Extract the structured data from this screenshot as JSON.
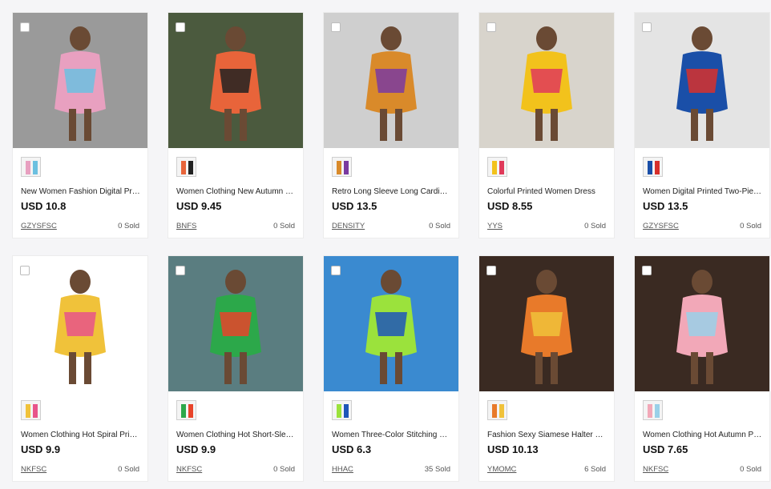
{
  "products": [
    {
      "title": "New Women Fashion Digital Print Shirt Casual Dress",
      "price": "USD 10.8",
      "shop": "GZYSFSC",
      "sold": "0 Sold",
      "bg": "#9a9a9a",
      "accent": "#e8a0c0",
      "accent2": "#6cc0e0"
    },
    {
      "title": "Women Clothing New Autumn Printed Two-Piece Set",
      "price": "USD 9.45",
      "shop": "BNFS",
      "sold": "0 Sold",
      "bg": "#4b5a3e",
      "accent": "#e8643a",
      "accent2": "#222222"
    },
    {
      "title": "Retro Long Sleeve Long Cardigan Tie-Dye Dress",
      "price": "USD 13.5",
      "shop": "DENSITY",
      "sold": "0 Sold",
      "bg": "#cfcfcf",
      "accent": "#d98a2a",
      "accent2": "#7a3aa0"
    },
    {
      "title": "Colorful Printed Women Dress",
      "price": "USD 8.55",
      "shop": "YYS",
      "sold": "0 Sold",
      "bg": "#d8d4cc",
      "accent": "#f2c21c",
      "accent2": "#e03a5a"
    },
    {
      "title": "Women Digital Printed Two-Piece Set",
      "price": "USD 13.5",
      "shop": "GZYSFSC",
      "sold": "0 Sold",
      "bg": "#e4e4e4",
      "accent": "#1a4fa8",
      "accent2": "#d8302c"
    },
    {
      "title": "Women Clothing Hot Spiral Print Tie-Dye Suit",
      "price": "USD 9.9",
      "shop": "NKFSC",
      "sold": "0 Sold",
      "bg": "#ffffff",
      "accent": "#f0c23a",
      "accent2": "#e8548a"
    },
    {
      "title": "Women Clothing Hot Short-Sleeve Printed Jumpsuit",
      "price": "USD 9.9",
      "shop": "NKFSC",
      "sold": "0 Sold",
      "bg": "#5a7d80",
      "accent": "#2ca84a",
      "accent2": "#e8442a"
    },
    {
      "title": "Women Three-Color Stitching Swimsuit",
      "price": "USD 6.3",
      "shop": "HHAC",
      "sold": "35 Sold",
      "bg": "#3a8ad0",
      "accent": "#9be23c",
      "accent2": "#1e56b8"
    },
    {
      "title": "Fashion Sexy Siamese Halter Bikini Set",
      "price": "USD 10.13",
      "shop": "YMOMC",
      "sold": "6 Sold",
      "bg": "#3a2a22",
      "accent": "#e87a2a",
      "accent2": "#f0c23a"
    },
    {
      "title": "Women Clothing Hot Autumn Printed Jumpsuit",
      "price": "USD 7.65",
      "shop": "NKFSC",
      "sold": "0 Sold",
      "bg": "#3a2a22",
      "accent": "#f2a8b8",
      "accent2": "#9ad0e8"
    }
  ]
}
